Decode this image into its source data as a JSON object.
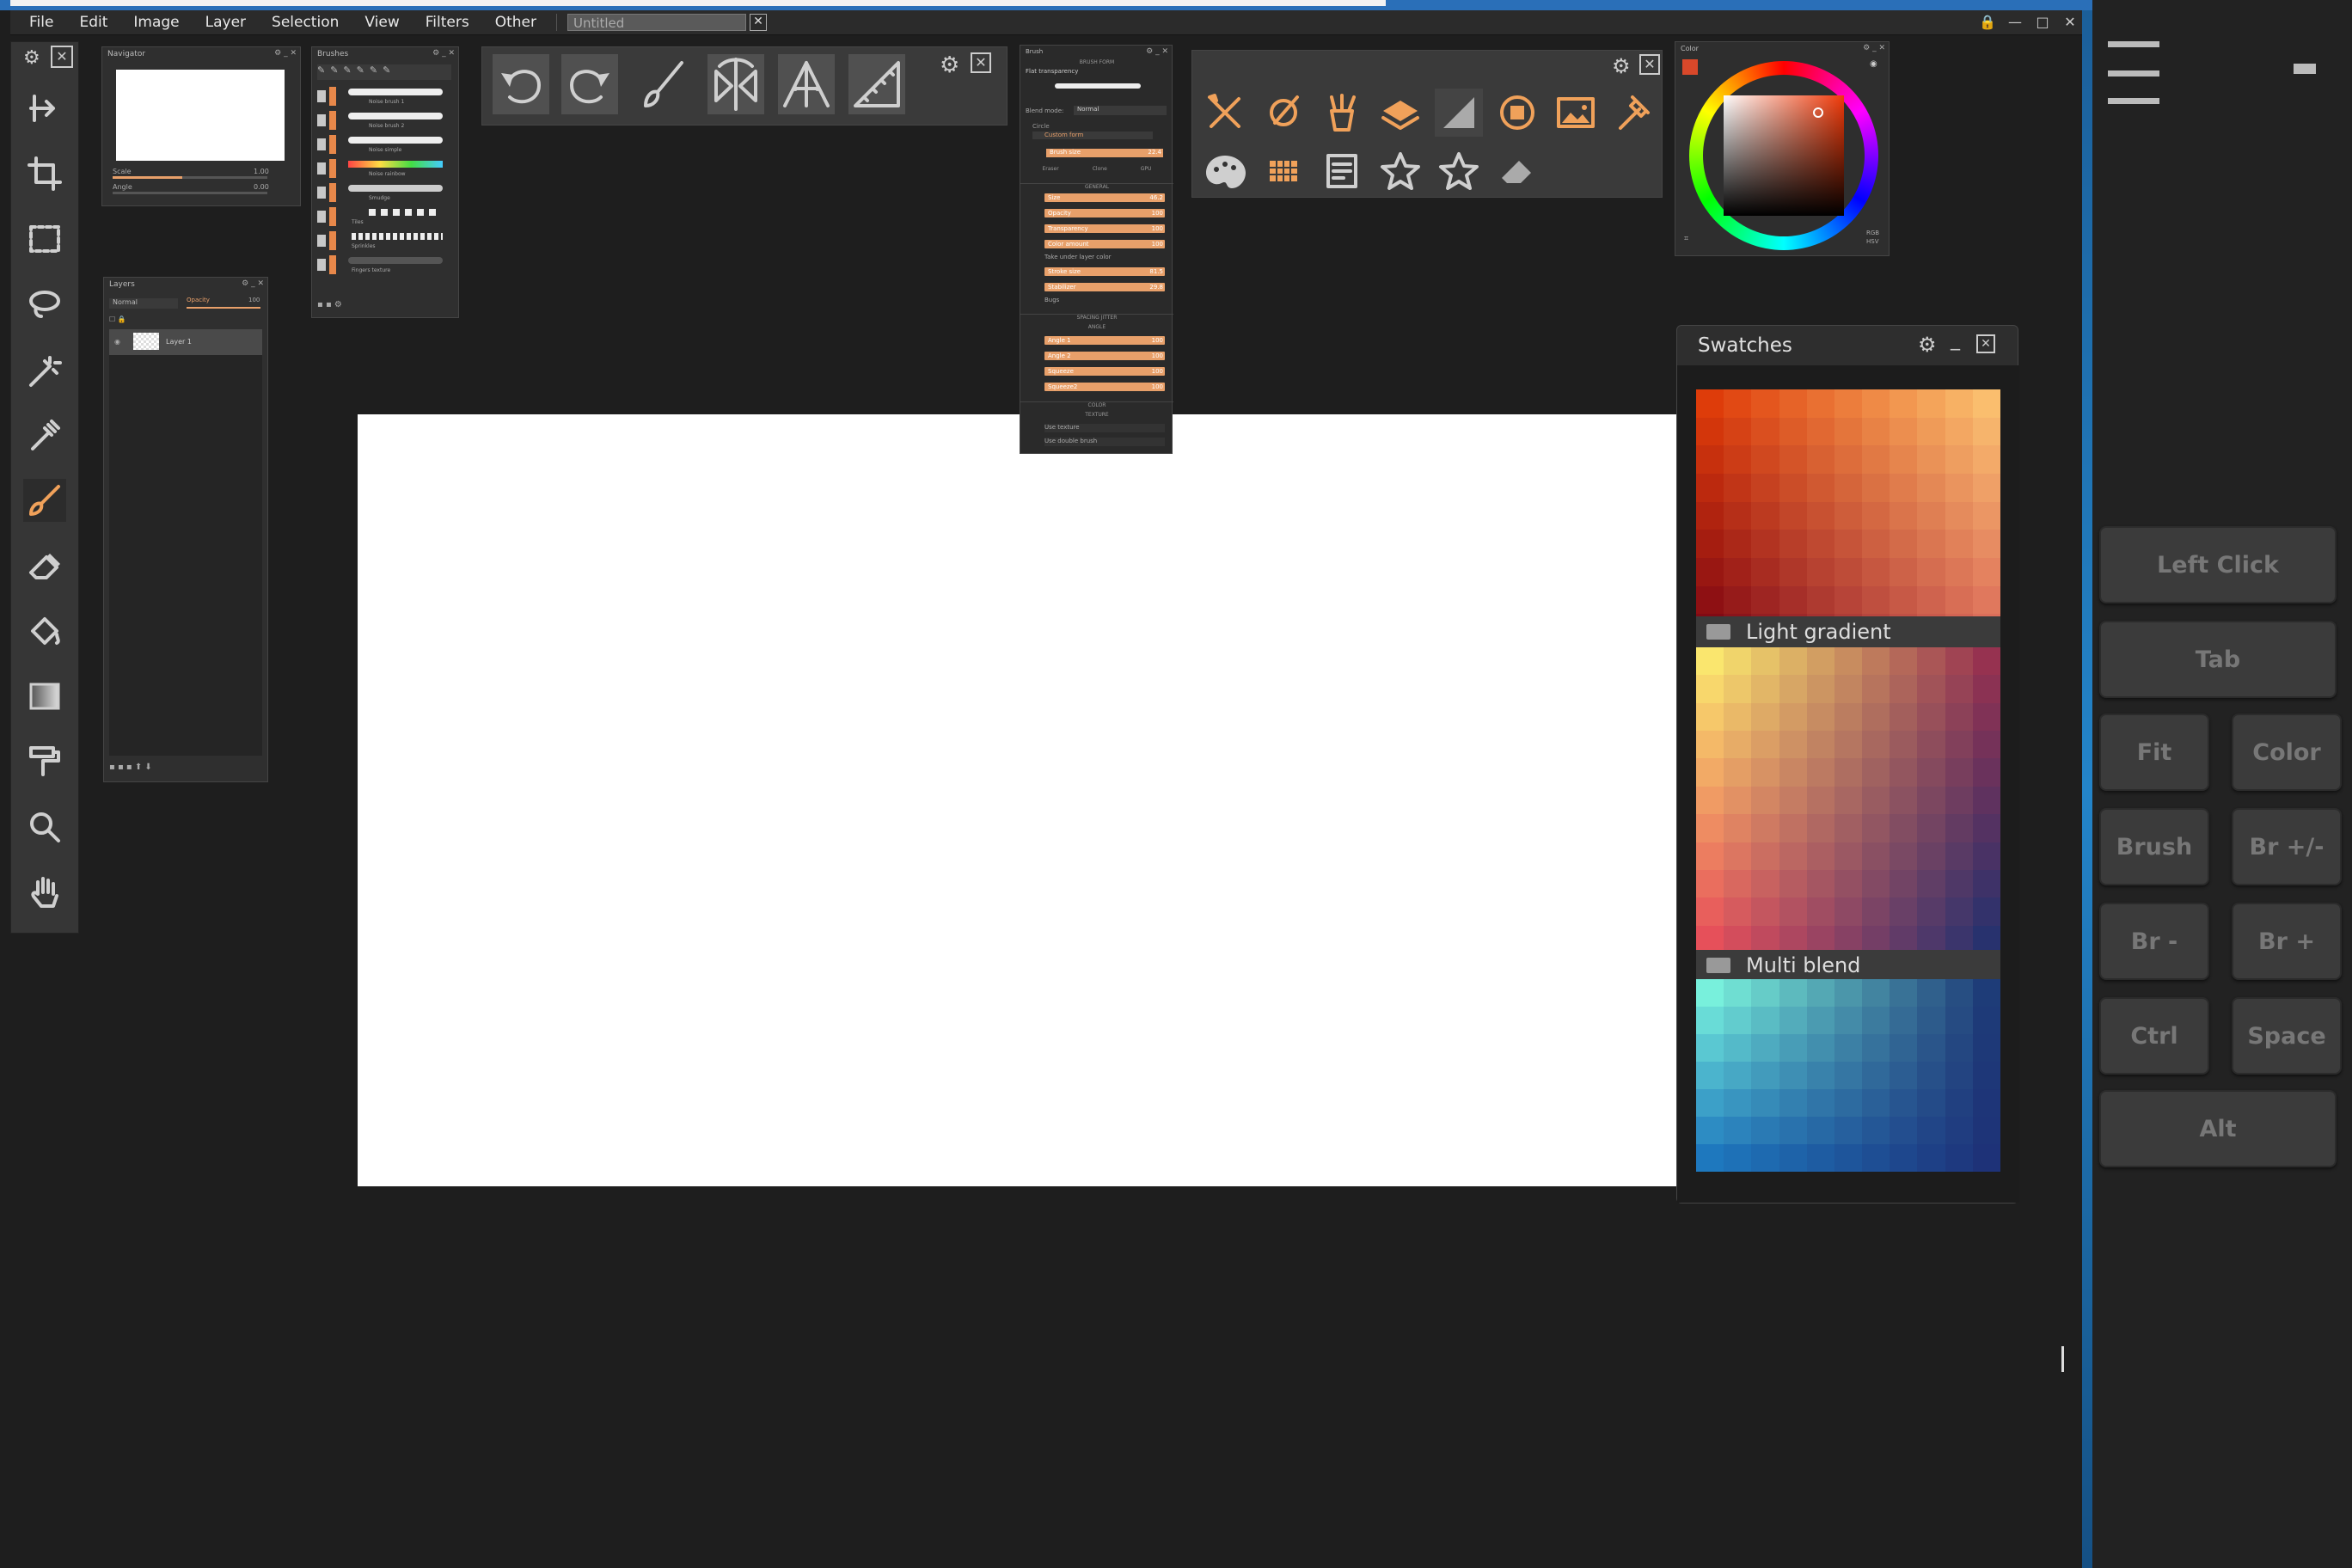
{
  "menubar": {
    "items": [
      "File",
      "Edit",
      "Image",
      "Layer",
      "Selection",
      "View",
      "Filters",
      "Other"
    ],
    "document_tab": "Untitled"
  },
  "navigator": {
    "title": "Navigator",
    "scale_label": "Scale",
    "scale_value": "1.00",
    "angle_label": "Angle",
    "angle_value": "0.00"
  },
  "layers": {
    "title": "Layers",
    "blend_mode": "Normal",
    "opacity_label": "Opacity",
    "opacity_value": "100",
    "layer_name": "Layer 1"
  },
  "brushes": {
    "title": "Brushes",
    "items": [
      "Noise brush 1",
      "Noise brush 2",
      "Noise simple",
      "Noise rainbow",
      "Smudge",
      "Tiles",
      "Sprinkles",
      "Fingers texture"
    ]
  },
  "brush_panel": {
    "title": "Brush",
    "section_brushtip": "BRUSH FORM",
    "flat_transparency": "Flat transparency",
    "blend_mode_label": "Blend mode:",
    "blend_mode_value": "Normal",
    "form_circle": "Circle",
    "form_custom": "Custom form",
    "brush_size_label": "Brush size",
    "brush_size_value": "22.4",
    "eraser": "Eraser",
    "clone": "Clone",
    "gpu": "GPU",
    "section_general": "GENERAL",
    "general_rows": [
      {
        "label": "Size",
        "value": "46.2"
      },
      {
        "label": "Opacity",
        "value": "100"
      },
      {
        "label": "Transparency",
        "value": "100"
      },
      {
        "label": "Color amount",
        "value": "100"
      }
    ],
    "take_color": "Take under layer color",
    "rows2": [
      {
        "label": "Stroke size",
        "value": "81.5"
      },
      {
        "label": "Stabilizer",
        "value": "29.8"
      }
    ],
    "bugs": "Bugs",
    "section_spacing": "SPACING JITTER",
    "section_angle": "ANGLE",
    "angle_rows": [
      {
        "label": "Angle 1",
        "value": "100"
      },
      {
        "label": "Angle 2",
        "value": "100"
      },
      {
        "label": "Squeeze",
        "value": "100"
      },
      {
        "label": "Squeeze2",
        "value": "100"
      }
    ],
    "section_color": "COLOR",
    "section_texture": "TEXTURE",
    "use_texture": "Use texture",
    "use_double": "Use double brush"
  },
  "color_panel": {
    "title": "Color",
    "mode_rgb": "RGB",
    "mode_hsv": "HSV",
    "current_color": "#d9482a"
  },
  "swatches": {
    "title": "Swatches",
    "groups": [
      "Light gradient",
      "Multi blend"
    ]
  },
  "keypad": {
    "left_click": "Left Click",
    "tab": "Tab",
    "fit": "Fit",
    "color": "Color",
    "brush": "Brush",
    "br_pm": "Br +/-",
    "br_minus": "Br -",
    "br_plus": "Br +",
    "ctrl": "Ctrl",
    "space": "Space",
    "alt": "Alt"
  },
  "colors": {
    "accent": "#f0a15a",
    "canvas": "#ffffff",
    "background": "#1e1e1e"
  }
}
